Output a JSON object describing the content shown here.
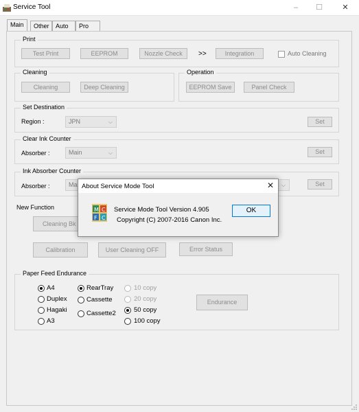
{
  "window": {
    "title": "Service Tool",
    "minimize": "–",
    "maximize": "☐",
    "close": "✕"
  },
  "tabs": [
    "Main",
    "Other",
    "Auto",
    "Pro"
  ],
  "print": {
    "label": "Print",
    "test_print": "Test Print",
    "eeprom": "EEPROM",
    "nozzle_check": "Nozzle Check",
    "arrow": ">>",
    "integration": "Integration",
    "auto_cleaning": "Auto Cleaning"
  },
  "cleaning": {
    "label": "Cleaning",
    "cleaning": "Cleaning",
    "deep_cleaning": "Deep Cleaning"
  },
  "operation": {
    "label": "Operation",
    "eeprom_save": "EEPROM Save",
    "panel_check": "Panel Check"
  },
  "set_destination": {
    "label": "Set Destination",
    "region_label": "Region :",
    "region_value": "JPN",
    "set": "Set"
  },
  "clear_ink_counter": {
    "label": "Clear Ink Counter",
    "absorber_label": "Absorber :",
    "absorber_value": "Main",
    "set": "Set"
  },
  "ink_absorber_counter": {
    "label": "Ink Absorber Counter",
    "absorber_label": "Absorber :",
    "absorber_value": "Ma",
    "set": "Set"
  },
  "new_function": {
    "label": "New Function",
    "cleaning_bk": "Cleaning Bk",
    "calibration": "Calibration",
    "user_cleaning_off": "User Cleaning OFF",
    "error_status": "Error Status"
  },
  "paper_feed": {
    "label": "Paper Feed Endurance",
    "size_options": [
      "A4",
      "Duplex",
      "Hagaki",
      "A3"
    ],
    "size_selected": "A4",
    "source_options": [
      "RearTray",
      "Cassette",
      "Cassette2"
    ],
    "source_selected": "RearTray",
    "copy_options": [
      "10 copy",
      "20 copy",
      "50 copy",
      "100 copy"
    ],
    "copy_selected": "50 copy",
    "endurance": "Endurance"
  },
  "about_dialog": {
    "title": "About Service Mode Tool",
    "close": "✕",
    "line1": "Service Mode Tool   Version 4.905",
    "line2": "Copyright (C) 2007-2016 Canon Inc.",
    "ok": "OK"
  }
}
